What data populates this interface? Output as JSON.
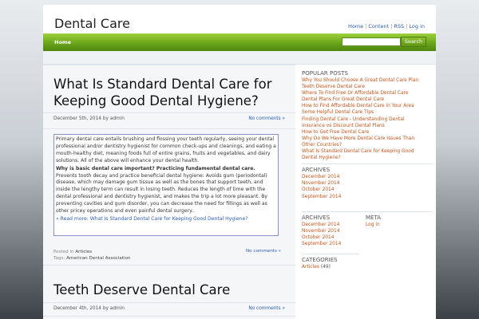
{
  "site": {
    "title": "Dental Care",
    "top_links": [
      "Home",
      "Content",
      "RSS",
      "Log in"
    ]
  },
  "nav": {
    "home": "Home",
    "search_value": "",
    "search_button": "Search"
  },
  "posts": [
    {
      "title": "What Is Standard Dental Care for Keeping Good Dental Hygiene?",
      "date": "December 5th, 2014",
      "author": "admin",
      "comments": "No comments »",
      "excerpt_p1": "Primary dental care entails brushing and flossing your teeth regularly, seeing your dental professional and/or dentistry hygienist for common check-ups and cleanings, and eating a mouth-healthy diet, meaning foods full of entire grains, fruits and vegetables, and dairy solutions. All of the above will enhance your dental health.",
      "excerpt_q": "Why is basic dental care important? Practicing fundamental dental care.",
      "excerpt_p2": "Prevents tooth decay and practice beneficial dental hygiene: Avoids gum (periodontal) disease, which may damage gum tissue as well as the bones that support teeth, and inside the lengthy term can result in losing teeth. Reduces the length of time with the dental professional and dentistry hygienist, and makes the trip a lot more pleasant. By preventing cavities and gum disorder, you can decrease the need for fillings as well as other pricey operations and even painful dental surgery..",
      "read_more": "» Read more: What Is Standard Dental Care for Keeping Good Dental Hygiene?",
      "posted_in_label": "Posted in",
      "category": "Articles",
      "tags_label": "Tags:",
      "tag": "American Dental Association",
      "footer_comments": "No comments »"
    },
    {
      "title": "Teeth Deserve Dental Care",
      "date": "December 4th, 2014",
      "author": "admin",
      "comments": "No comments »"
    }
  ],
  "by_label": "by",
  "sidebar": {
    "popular_title": "POPULAR POSTS",
    "popular_posts": [
      "Why You Should Choose A Great Dental Care Plan",
      "Teeth Deserve Dental Care",
      "Where To Find Free Or Affordable Dental Care",
      "Dental Plans For Great Dental Care",
      "How to Find Affordable Dental Care in Your Area",
      "Some Helpful Dental Care Tips",
      "Finding Dental Care - Understanding Dental",
      "Insurance vs Discount Dental Plans",
      "How to Get Free Dental Care",
      "Why Do We Have More Dental Care Issues Than",
      "Other Countries?",
      "What Is Standard Dental Care for Keeping Good",
      "Dental Hygiene?"
    ],
    "archives_title": "ARCHIVES",
    "archives": [
      "December 2014",
      "November 2014",
      "October 2014",
      "September 2014"
    ],
    "archives2_title": "ARCHIVES",
    "archives2": [
      "December 2014",
      "November 2014",
      "October 2014",
      "September 2014"
    ],
    "meta_title": "META",
    "meta_links": [
      "Log in"
    ],
    "categories_title": "CATEGORIES",
    "category_link": "Articles",
    "category_count": "(49)"
  }
}
